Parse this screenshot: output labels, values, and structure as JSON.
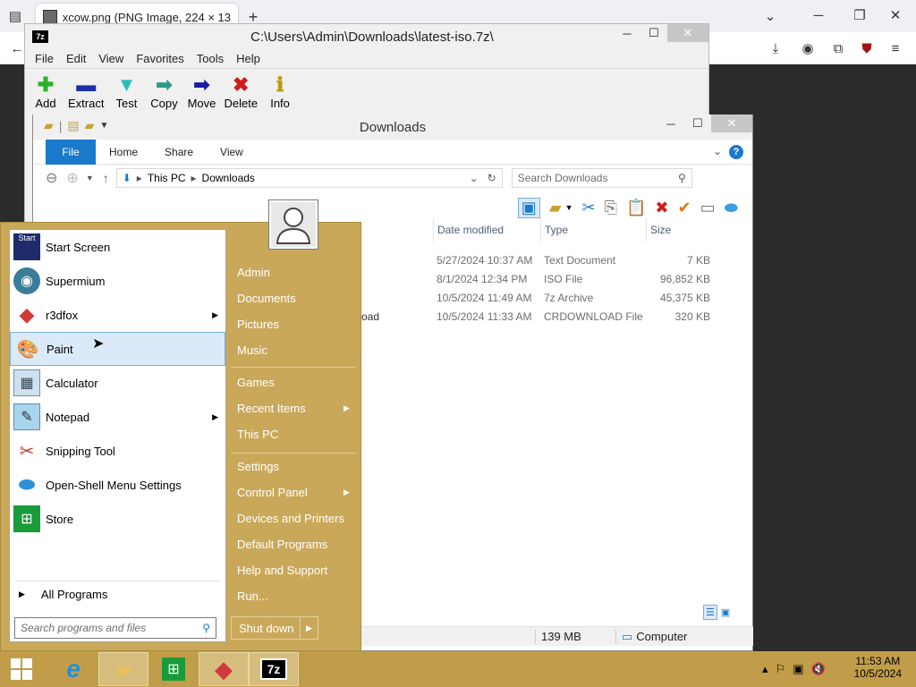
{
  "browser": {
    "tab_title": "xcow.png (PNG Image, 224 × 13",
    "new_tab": "+"
  },
  "zip": {
    "title": "C:\\Users\\Admin\\Downloads\\latest-iso.7z\\",
    "logo": "7z",
    "menu": [
      "File",
      "Edit",
      "View",
      "Favorites",
      "Tools",
      "Help"
    ],
    "tools": [
      {
        "label": "Add",
        "icon": "plus-icon",
        "color": "#2bb12b",
        "glyph": "✚"
      },
      {
        "label": "Extract",
        "icon": "minus-icon",
        "color": "#1c2fa8",
        "glyph": "▬"
      },
      {
        "label": "Test",
        "icon": "check-down-icon",
        "color": "#2bbcbc",
        "glyph": "▼"
      },
      {
        "label": "Copy",
        "icon": "copy-arrow-icon",
        "color": "#2a9b8a",
        "glyph": "➡"
      },
      {
        "label": "Move",
        "icon": "move-arrow-icon",
        "color": "#1a1ba0",
        "glyph": "➡"
      },
      {
        "label": "Delete",
        "icon": "delete-x-icon",
        "color": "#d11a1a",
        "glyph": "✖"
      },
      {
        "label": "Info",
        "icon": "info-icon",
        "color": "#b99a10",
        "glyph": "ℹ"
      }
    ]
  },
  "explorer": {
    "title": "Downloads",
    "ribbon": [
      "File",
      "Home",
      "Share",
      "View"
    ],
    "path": [
      "This PC",
      "Downloads"
    ],
    "search_placeholder": "Search Downloads",
    "columns": [
      "Date modified",
      "Type",
      "Size"
    ],
    "files": [
      {
        "date": "5/27/2024 10:37 AM",
        "type": "Text Document",
        "size": "7 KB"
      },
      {
        "date": "8/1/2024 12:34 PM",
        "type": "ISO File",
        "size": "96,852 KB"
      },
      {
        "date": "10/5/2024 11:49 AM",
        "type": "7z Archive",
        "size": "45,375 KB"
      },
      {
        "date": "10/5/2024 11:33 AM",
        "type": "CRDOWNLOAD File",
        "size": "320 KB"
      }
    ],
    "partial_name": "oad",
    "status_size": "139 MB",
    "status_location": "Computer"
  },
  "start_menu": {
    "programs": [
      {
        "label": "Start Screen",
        "icon": "start-screen-icon",
        "arrow": false
      },
      {
        "label": "Supermium",
        "icon": "supermium-icon",
        "arrow": false
      },
      {
        "label": "r3dfox",
        "icon": "r3dfox-icon",
        "arrow": true
      },
      {
        "label": "Paint",
        "icon": "paint-icon",
        "arrow": false
      },
      {
        "label": "Calculator",
        "icon": "calculator-icon",
        "arrow": false
      },
      {
        "label": "Notepad",
        "icon": "notepad-icon",
        "arrow": true
      },
      {
        "label": "Snipping Tool",
        "icon": "snipping-tool-icon",
        "arrow": false
      },
      {
        "label": "Open-Shell Menu Settings",
        "icon": "open-shell-icon",
        "arrow": false
      },
      {
        "label": "Store",
        "icon": "store-icon",
        "arrow": false
      }
    ],
    "start_icon_text": "Start",
    "all_programs": "All Programs",
    "search_placeholder": "Search programs and files",
    "right_items": [
      {
        "label": "Admin",
        "arrow": false
      },
      {
        "label": "Documents",
        "arrow": false
      },
      {
        "label": "Pictures",
        "arrow": false
      },
      {
        "label": "Music",
        "arrow": false
      },
      {
        "label": "Games",
        "arrow": false
      },
      {
        "label": "Recent Items",
        "arrow": true
      },
      {
        "label": "This PC",
        "arrow": false
      },
      {
        "label": "Settings",
        "arrow": false
      },
      {
        "label": "Control Panel",
        "arrow": true
      },
      {
        "label": "Devices and Printers",
        "arrow": false
      },
      {
        "label": "Default Programs",
        "arrow": false
      },
      {
        "label": "Help and Support",
        "arrow": false
      },
      {
        "label": "Run...",
        "arrow": false
      }
    ],
    "shutdown": "Shut down"
  },
  "taskbar": {
    "time": "11:53 AM",
    "date": "10/5/2024",
    "zip_label": "7z"
  },
  "colors": {
    "accent_gold": "#caa85a",
    "file_tab": "#1979ca"
  }
}
